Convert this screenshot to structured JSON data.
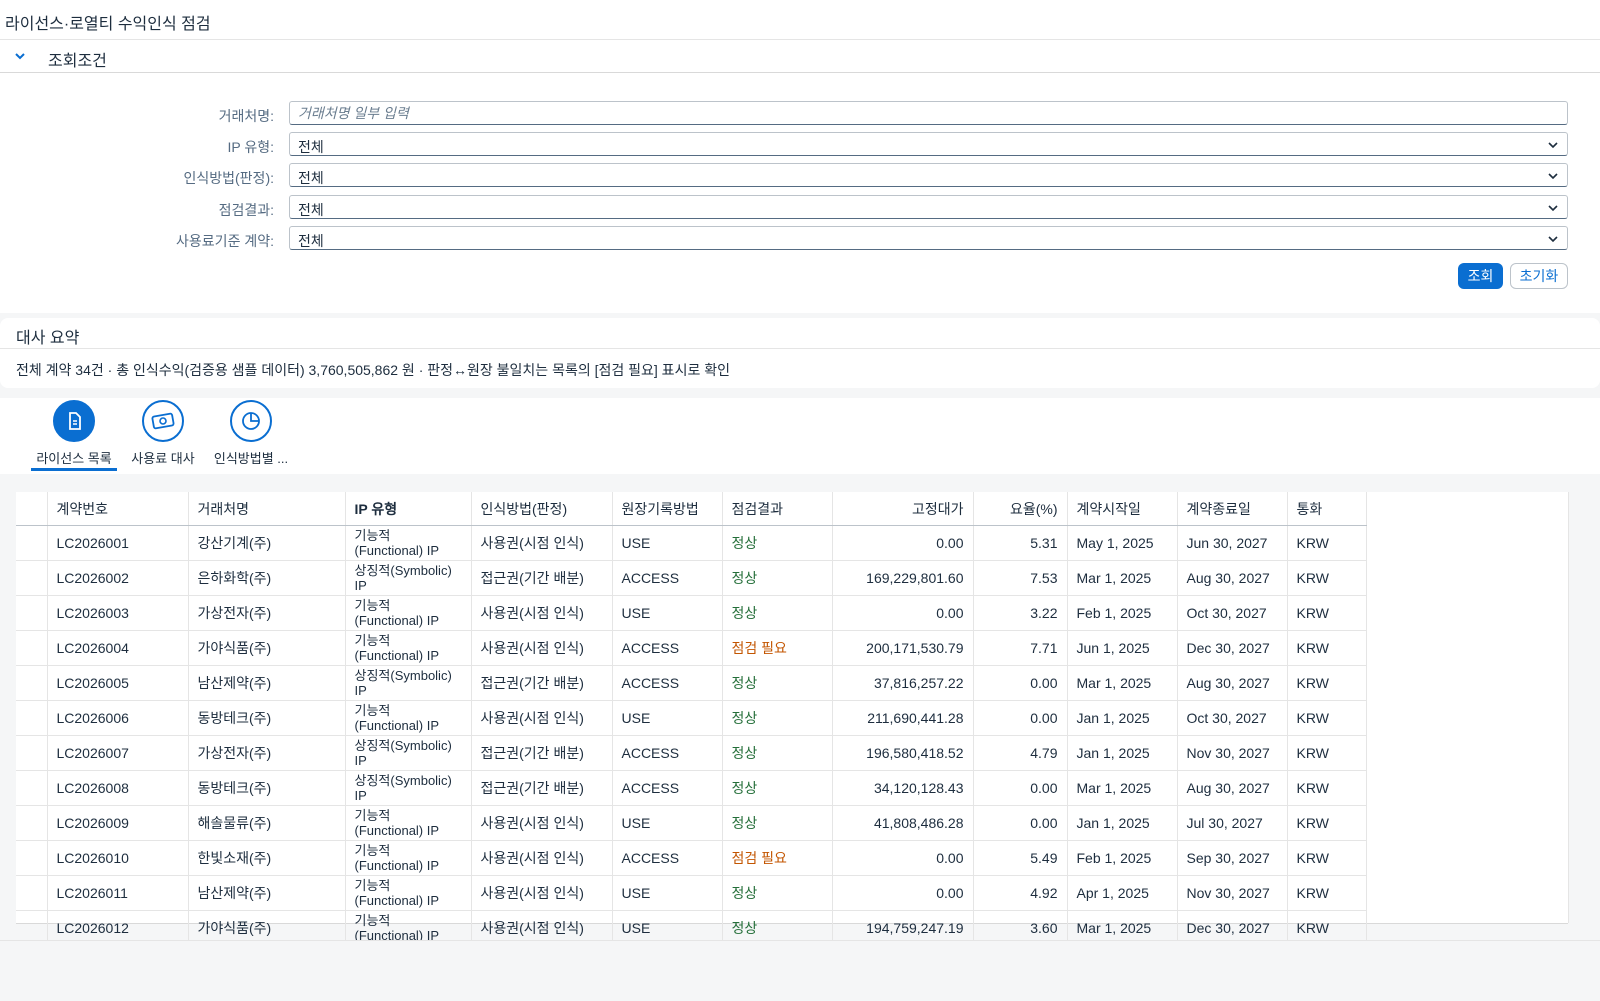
{
  "app": {
    "title": "라이선스·로열티 수익인식 점검"
  },
  "filter": {
    "section_title": "조회조건",
    "fields": [
      {
        "label": "거래처명:",
        "placeholder": "거래처명 일부 입력",
        "value": ""
      },
      {
        "label": "IP 유형:",
        "value": "전체"
      },
      {
        "label": "인식방법(판정):",
        "value": "전체"
      },
      {
        "label": "점검결과:",
        "value": "전체"
      },
      {
        "label": "사용료기준 계약:",
        "value": "전체"
      }
    ],
    "search_label": "조회",
    "reset_label": "초기화"
  },
  "summary": {
    "title": "대사 요약",
    "text": "전체 계약 34건 · 총 인식수익(검증용 샘플 데이터) 3,760,505,862 원 · 판정↔원장 불일치는 목록의 [점검 필요] 표시로 확인"
  },
  "tabs": [
    {
      "label": "라이선스 목록",
      "icon": "document-icon",
      "active": true
    },
    {
      "label": "사용료 대사",
      "icon": "money-icon",
      "active": false
    },
    {
      "label": "인식방법별 ...",
      "icon": "pie-chart-icon",
      "active": false
    }
  ],
  "table": {
    "columns": [
      "계약번호",
      "거래처명",
      "IP 유형",
      "인식방법(판정)",
      "원장기록방법",
      "점검결과",
      "고정대가",
      "요율(%)",
      "계약시작일",
      "계약종료일",
      "통화"
    ],
    "rows": [
      [
        "LC2026001",
        "강산기계(주)",
        "기능적\n(Functional) IP",
        "사용권(시점 인식)",
        "USE",
        "정상",
        "0.00",
        "5.31",
        "May 1, 2025",
        "Jun 30, 2027",
        "KRW"
      ],
      [
        "LC2026002",
        "은하화학(주)",
        "상징적(Symbolic)\nIP",
        "접근권(기간 배분)",
        "ACCESS",
        "정상",
        "169,229,801.60",
        "7.53",
        "Mar 1, 2025",
        "Aug 30, 2027",
        "KRW"
      ],
      [
        "LC2026003",
        "가상전자(주)",
        "기능적\n(Functional) IP",
        "사용권(시점 인식)",
        "USE",
        "정상",
        "0.00",
        "3.22",
        "Feb 1, 2025",
        "Oct 30, 2027",
        "KRW"
      ],
      [
        "LC2026004",
        "가야식품(주)",
        "기능적\n(Functional) IP",
        "사용권(시점 인식)",
        "ACCESS",
        "점검 필요",
        "200,171,530.79",
        "7.71",
        "Jun 1, 2025",
        "Dec 30, 2027",
        "KRW"
      ],
      [
        "LC2026005",
        "남산제약(주)",
        "상징적(Symbolic)\nIP",
        "접근권(기간 배분)",
        "ACCESS",
        "정상",
        "37,816,257.22",
        "0.00",
        "Mar 1, 2025",
        "Aug 30, 2027",
        "KRW"
      ],
      [
        "LC2026006",
        "동방테크(주)",
        "기능적\n(Functional) IP",
        "사용권(시점 인식)",
        "USE",
        "정상",
        "211,690,441.28",
        "0.00",
        "Jan 1, 2025",
        "Oct 30, 2027",
        "KRW"
      ],
      [
        "LC2026007",
        "가상전자(주)",
        "상징적(Symbolic)\nIP",
        "접근권(기간 배분)",
        "ACCESS",
        "정상",
        "196,580,418.52",
        "4.79",
        "Jan 1, 2025",
        "Nov 30, 2027",
        "KRW"
      ],
      [
        "LC2026008",
        "동방테크(주)",
        "상징적(Symbolic)\nIP",
        "접근권(기간 배분)",
        "ACCESS",
        "정상",
        "34,120,128.43",
        "0.00",
        "Mar 1, 2025",
        "Aug 30, 2027",
        "KRW"
      ],
      [
        "LC2026009",
        "해솔물류(주)",
        "기능적\n(Functional) IP",
        "사용권(시점 인식)",
        "USE",
        "정상",
        "41,808,486.28",
        "0.00",
        "Jan 1, 2025",
        "Jul 30, 2027",
        "KRW"
      ],
      [
        "LC2026010",
        "한빛소재(주)",
        "기능적\n(Functional) IP",
        "사용권(시점 인식)",
        "ACCESS",
        "점검 필요",
        "0.00",
        "5.49",
        "Feb 1, 2025",
        "Sep 30, 2027",
        "KRW"
      ],
      [
        "LC2026011",
        "남산제약(주)",
        "기능적\n(Functional) IP",
        "사용권(시점 인식)",
        "USE",
        "정상",
        "0.00",
        "4.92",
        "Apr 1, 2025",
        "Nov 30, 2027",
        "KRW"
      ],
      [
        "LC2026012",
        "가야식품(주)",
        "기능적\n(Functional) IP",
        "사용권(시점 인식)",
        "USE",
        "정상",
        "194,759,247.19",
        "3.60",
        "Mar 1, 2025",
        "Dec 30, 2027",
        "KRW"
      ]
    ]
  },
  "colors": {
    "accent": "#0a6ed1",
    "ok": "#256f3a",
    "warn": "#c35500"
  }
}
